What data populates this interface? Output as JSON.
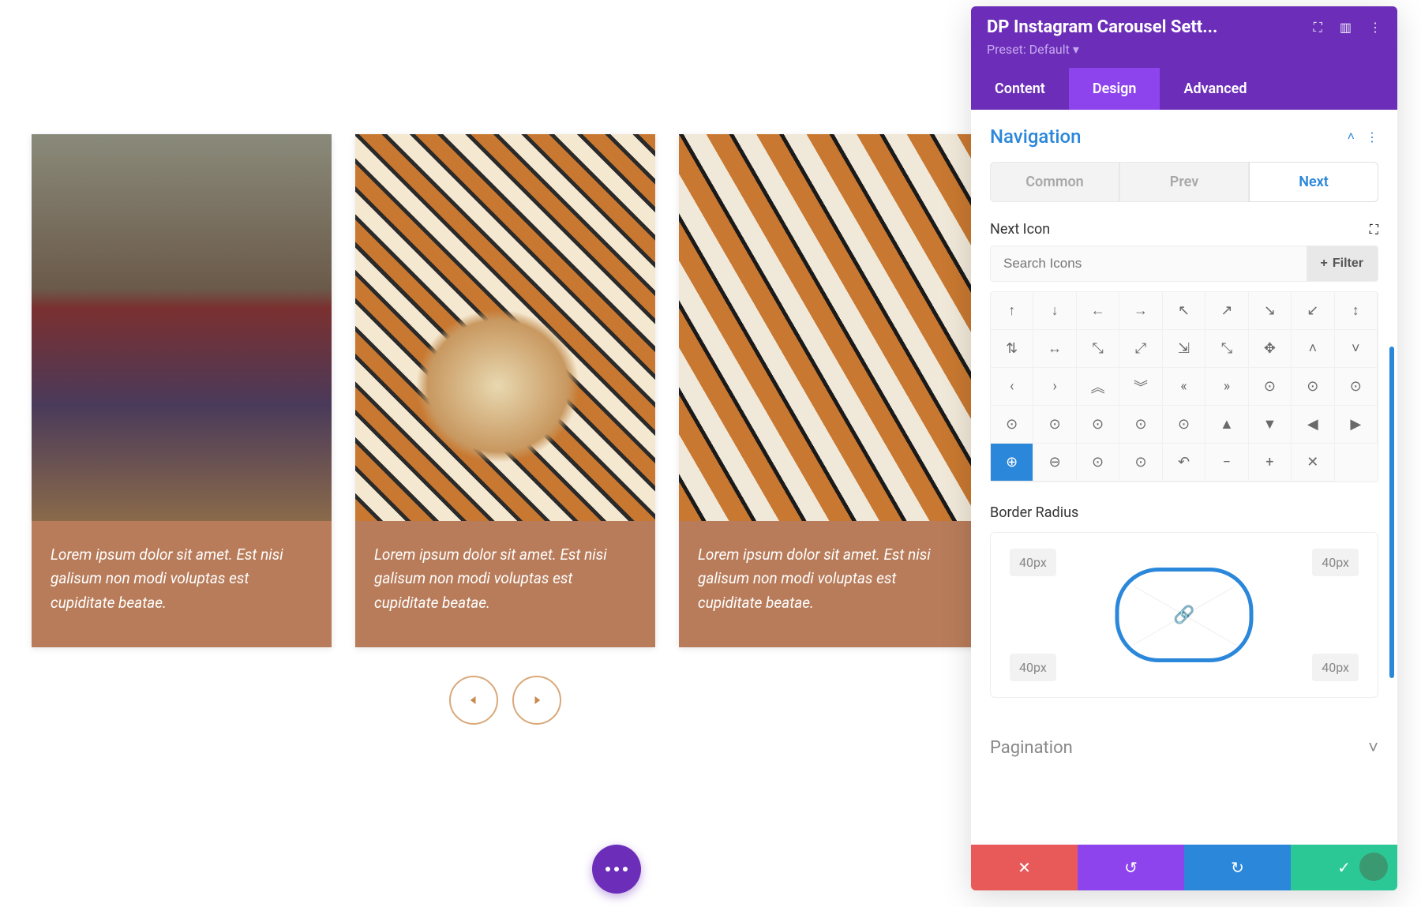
{
  "carousel": {
    "cards": [
      {
        "caption": "Lorem ipsum dolor sit amet. Est nisi galisum non modi voluptas est cupiditate beatae."
      },
      {
        "caption": "Lorem ipsum dolor sit amet. Est nisi galisum non modi voluptas est cupiditate beatae."
      },
      {
        "caption": "Lorem ipsum dolor sit amet. Est nisi galisum non modi voluptas est cupiditate beatae."
      }
    ]
  },
  "panel": {
    "title": "DP Instagram Carousel Sett...",
    "preset": "Preset: Default ▾",
    "tabs": {
      "content": "Content",
      "design": "Design",
      "advanced": "Advanced"
    },
    "section_title": "Navigation",
    "subtabs": {
      "common": "Common",
      "prev": "Prev",
      "next": "Next"
    },
    "field_next_icon": "Next Icon",
    "search_placeholder": "Search Icons",
    "filter_label": "Filter",
    "icons": [
      "↑",
      "↓",
      "←",
      "→",
      "↖",
      "↗",
      "↘",
      "↙",
      "↕",
      "⇅",
      "↔",
      "⤡",
      "⤢",
      "⇲",
      "⤡",
      "✥",
      "˄",
      "˅",
      "‹",
      "›",
      "︽",
      "︾",
      "«",
      "»",
      "⊙",
      "⊙",
      "⊙",
      "⊙",
      "⊙",
      "⊙",
      "⊙",
      "⊙",
      "▲",
      "▼",
      "◀",
      "▶",
      "⊕",
      "⊖",
      "⊙",
      "⊙",
      "↶",
      "−",
      "+",
      "✕"
    ],
    "selected_icon_index": 36,
    "field_border_radius": "Border Radius",
    "radius": {
      "tl": "40px",
      "tr": "40px",
      "bl": "40px",
      "br": "40px"
    },
    "pagination_label": "Pagination"
  }
}
